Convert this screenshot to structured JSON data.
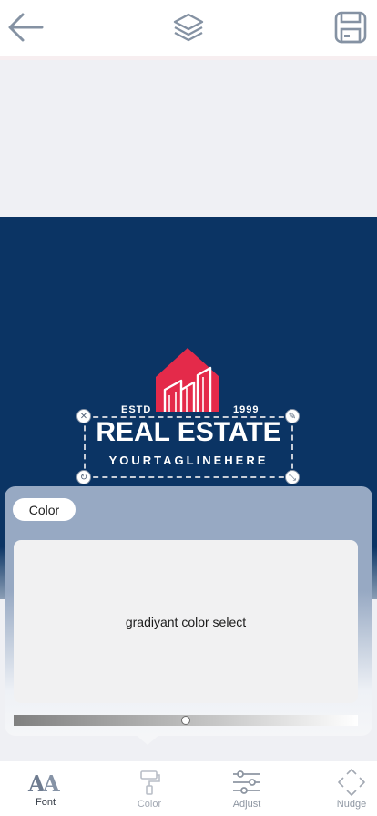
{
  "topbar": {
    "back_icon": "arrow-left-icon",
    "layers_icon": "layers-icon",
    "save_icon": "floppy-disk-icon"
  },
  "logo": {
    "estd": "ESTD",
    "year": "1999",
    "title": "REAL ESTATE",
    "tagline": "YOURTAGLINEHERE"
  },
  "panel": {
    "chip_label": "Color",
    "picker_text": "gradiyant color select",
    "gradient_position": 0.5
  },
  "tabs": [
    {
      "label": "Font",
      "icon": "font-icon"
    },
    {
      "label": "Color",
      "icon": "paint-roller-icon"
    },
    {
      "label": "Adjust",
      "icon": "sliders-icon"
    },
    {
      "label": "Nudge",
      "icon": "move-arrows-icon"
    }
  ],
  "colors": {
    "canvas": "#0b3464",
    "logo_red": "#e42a4a",
    "panel_top": "#97a9c3"
  }
}
